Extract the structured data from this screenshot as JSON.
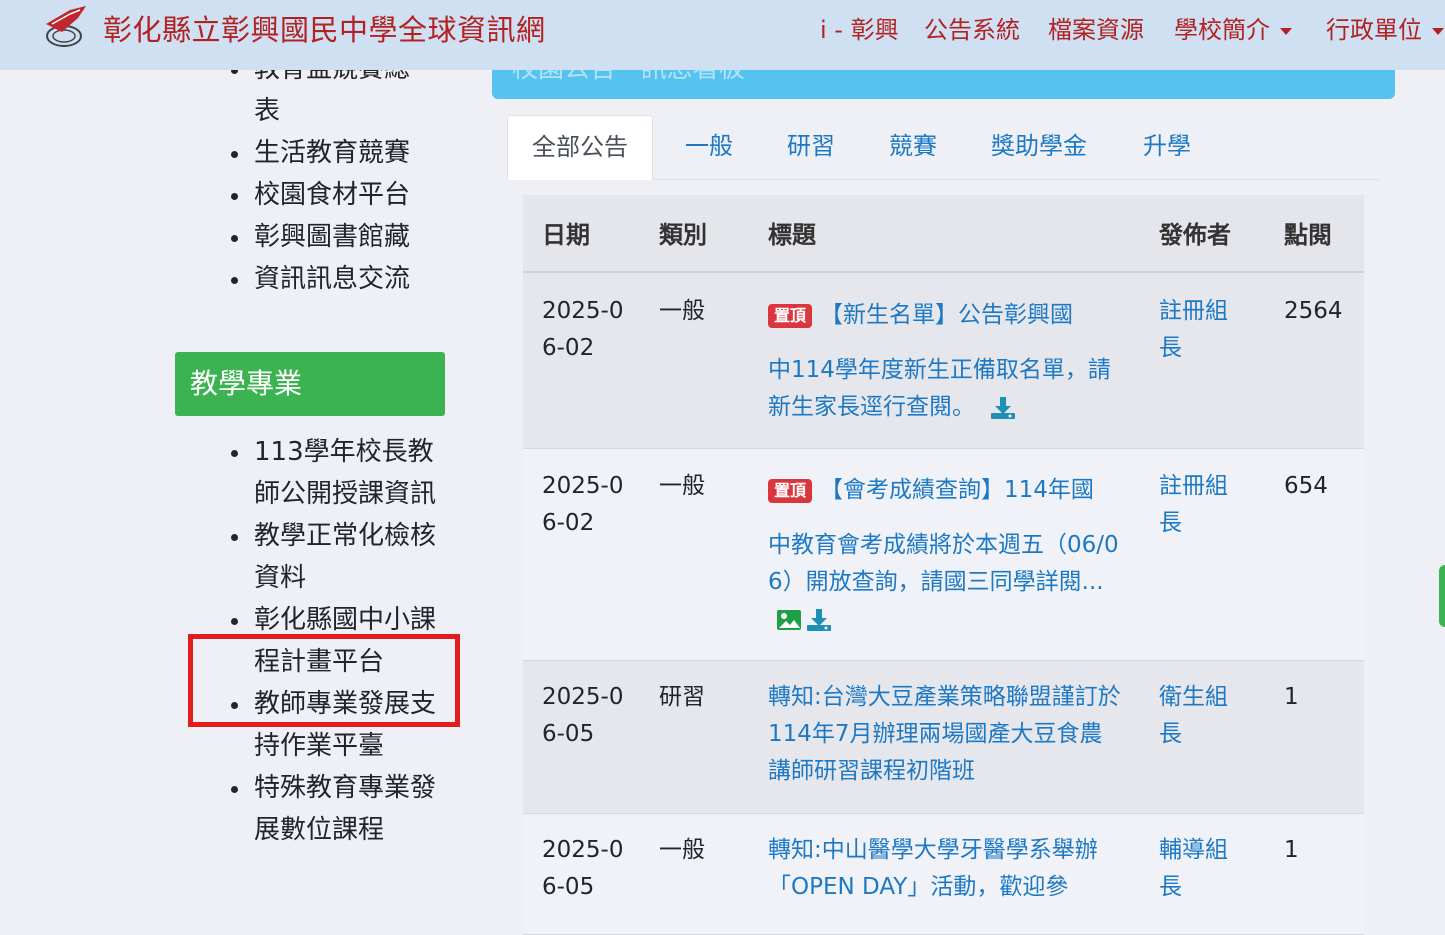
{
  "header": {
    "site_title": "彰化縣立彰興國民中學全球資訊網",
    "nav": [
      "i - 彰興",
      "公告系統",
      "檔案資源",
      "學校簡介",
      "行政單位"
    ]
  },
  "sidebar": {
    "clipped_top": "教育盃競賽總",
    "list_a": [
      "表",
      "生活教育競賽",
      "校園食材平台",
      "彰興圖書館藏",
      "資訊訊息交流"
    ],
    "section_title": "教學專業",
    "list_b": [
      "113學年校長教師公開授課資訊",
      "教學正常化檢核資料",
      "彰化縣國中小課程計畫平台",
      "教師專業發展支持作業平臺",
      "特殊教育專業發展數位課程"
    ]
  },
  "main": {
    "clipped_banner": "校園公告 · 訊息看板",
    "tabs": [
      "全部公告",
      "一般",
      "研習",
      "競賽",
      "獎助學金",
      "升學"
    ],
    "table_headers": {
      "date": "日期",
      "category": "類別",
      "title": "標題",
      "author": "發佈者",
      "views": "點閱"
    },
    "pin_badge": "置頂",
    "rows": [
      {
        "date": "2025-06-02",
        "category": "一般",
        "title_l1": "【新生名單】公告彰興國",
        "title_rest": "中114學年度新生正備取名單，請新生家長逕行查閱。",
        "author": "註冊組長",
        "views": "2564"
      },
      {
        "date": "2025-06-02",
        "category": "一般",
        "title_l1": "【會考成績查詢】114年國",
        "title_rest": "中教育會考成績將於本週五（06/06）開放查詢，請國三同學詳閱...",
        "author": "註冊組長",
        "views": "654"
      },
      {
        "date": "2025-06-05",
        "category": "研習",
        "title": "轉知:台灣大豆產業策略聯盟謹訂於114年7月辦理兩場國產大豆食農講師研習課程初階班",
        "author": "衛生組長",
        "views": "1"
      },
      {
        "date": "2025-06-05",
        "category": "一般",
        "title": "轉知:中山醫學大學牙醫學系舉辦「OPEN DAY」活動，歡迎參",
        "author": "輔導組長",
        "views": "1"
      }
    ]
  },
  "colors": {
    "brand_red": "#b22222",
    "link_blue": "#1d79c4",
    "green": "#3cb351",
    "cyan": "#55c2f0",
    "pin_red": "#d9363e",
    "highlight": "#e11d1d"
  }
}
